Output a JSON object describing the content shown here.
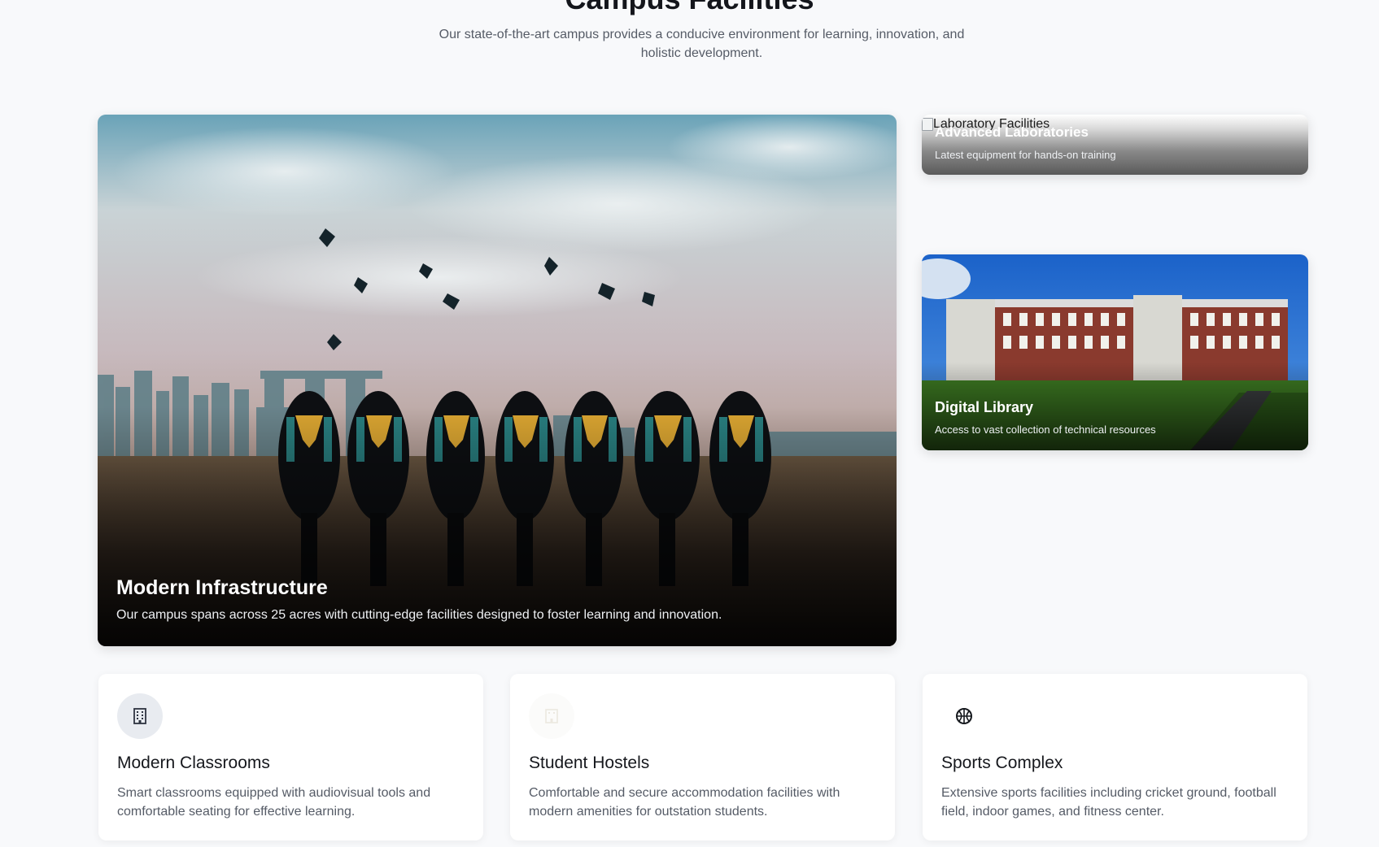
{
  "section": {
    "title": "Campus Facilities",
    "subtitle": "Our state-of-the-art campus provides a conducive environment for learning, innovation, and holistic development."
  },
  "feature": {
    "title": "Modern Infrastructure",
    "description": "Our campus spans across 25 acres with cutting-edge facilities designed to foster learning and innovation."
  },
  "side_cards": [
    {
      "image_alt": "Laboratory Facilities",
      "title": "Advanced Laboratories",
      "description": "Latest equipment for hands-on training"
    },
    {
      "title": "Digital Library",
      "description": "Access to vast collection of technical resources"
    }
  ],
  "info_cards": [
    {
      "icon": "building-icon",
      "title": "Modern Classrooms",
      "description": "Smart classrooms equipped with audiovisual tools and comfortable seating for effective learning."
    },
    {
      "icon": "hostel-icon",
      "title": "Student Hostels",
      "description": "Comfortable and secure accommodation facilities with modern amenities for outstation students."
    },
    {
      "icon": "basketball-icon",
      "title": "Sports Complex",
      "description": "Extensive sports facilities including cricket ground, football field, indoor games, and fitness center."
    }
  ],
  "colors": {
    "page_background": "#f8f9fb",
    "icon_circle": "#e8ebf0",
    "icon_color": "#2d3340"
  }
}
